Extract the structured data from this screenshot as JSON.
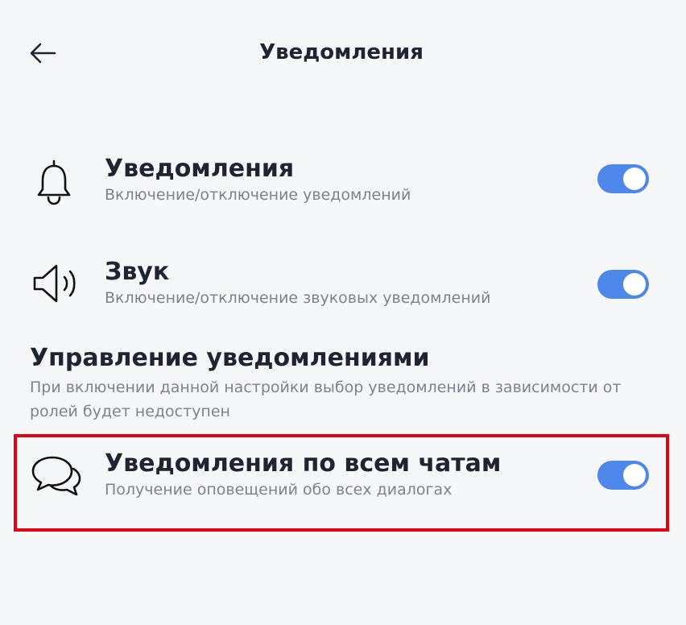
{
  "header": {
    "title": "Уведомления",
    "back_icon": "arrow-left-icon"
  },
  "settings": [
    {
      "icon": "bell-icon",
      "title": "Уведомления",
      "subtitle": "Включение/отключение уведомлений",
      "enabled": true
    },
    {
      "icon": "speaker-icon",
      "title": "Звук",
      "subtitle": "Включение/отключение звуковых уведомлений",
      "enabled": true
    }
  ],
  "management": {
    "title": "Управление уведомлениями",
    "description": "При включении данной настройки выбор уведомлений в зависимости от ролей будет недоступен",
    "item": {
      "icon": "chat-bubbles-icon",
      "title": "Уведомления по всем чатам",
      "subtitle": "Получение оповещений обо всех диалогах",
      "enabled": true
    }
  },
  "colors": {
    "background": "#f6f7f9",
    "toggle_on": "#4d87ea",
    "highlight": "#e3000f",
    "text_primary": "#1f2430",
    "text_secondary": "#7d828c"
  }
}
